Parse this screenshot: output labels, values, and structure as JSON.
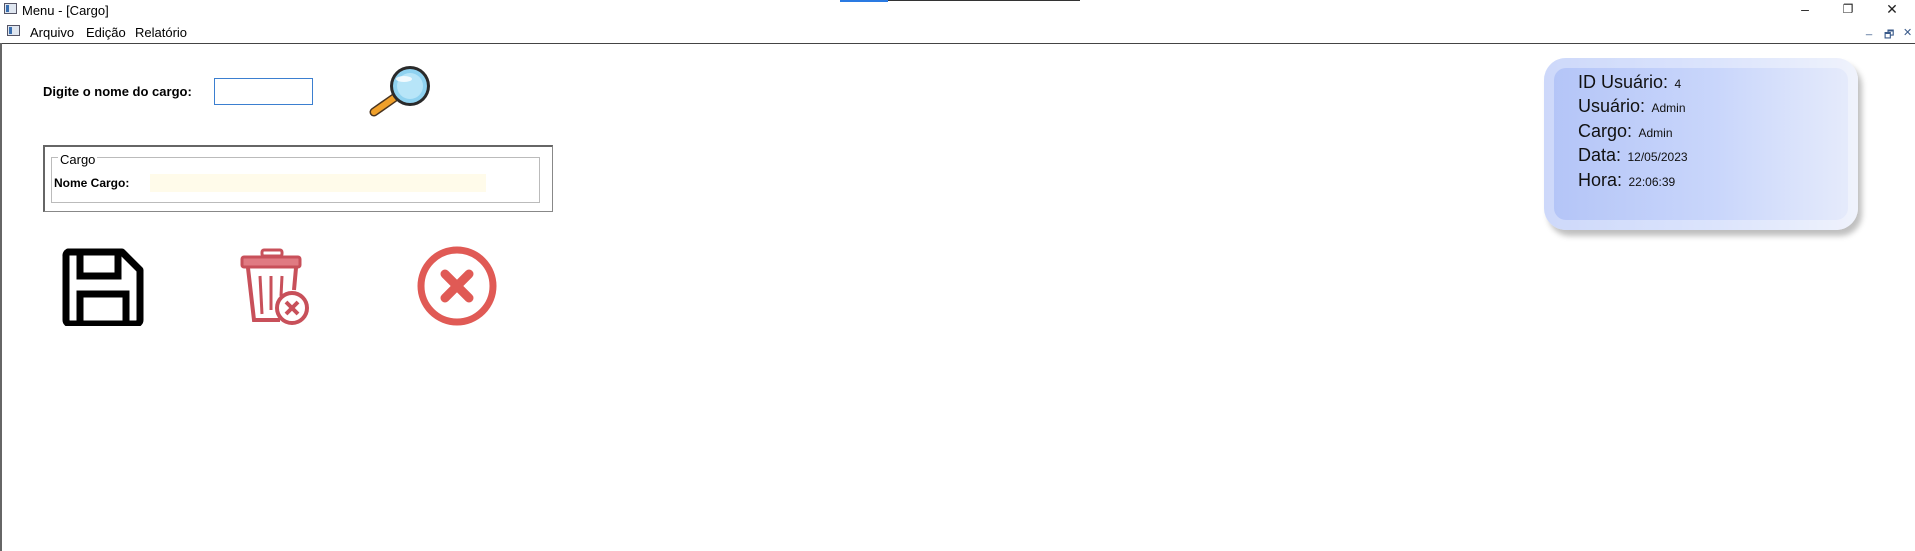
{
  "window": {
    "title": "Menu - [Cargo]",
    "minimize": "–",
    "restore": "❐",
    "close": "✕"
  },
  "menu": {
    "items": [
      {
        "label": "Arquivo"
      },
      {
        "label": "Edição"
      },
      {
        "label": "Relatório"
      }
    ],
    "mdi_minimize": "_",
    "mdi_restore": "🗗",
    "mdi_close": "✕"
  },
  "form": {
    "search_label": "Digite o nome do cargo:",
    "search_value": "",
    "group_title": "Cargo",
    "nome_label": "Nome Cargo:",
    "nome_value": ""
  },
  "user_info": {
    "id_label": "ID Usuário:",
    "id_value": "4",
    "user_label": "Usuário:",
    "user_value": "Admin",
    "cargo_label": "Cargo:",
    "cargo_value": "Admin",
    "data_label": "Data:",
    "data_value": "12/05/2023",
    "hora_label": "Hora:",
    "hora_value": "22:06:39"
  },
  "icons": {
    "search": "magnifier-icon",
    "save": "floppy-disk-icon",
    "delete": "trash-delete-icon",
    "cancel": "cancel-x-icon"
  },
  "colors": {
    "accent_blue": "#2a7ae2",
    "delete_red": "#c8505a",
    "cancel_red": "#e05a55",
    "card_gradient_start": "#b3c4f7",
    "card_gradient_end": "#e7ecfb"
  }
}
